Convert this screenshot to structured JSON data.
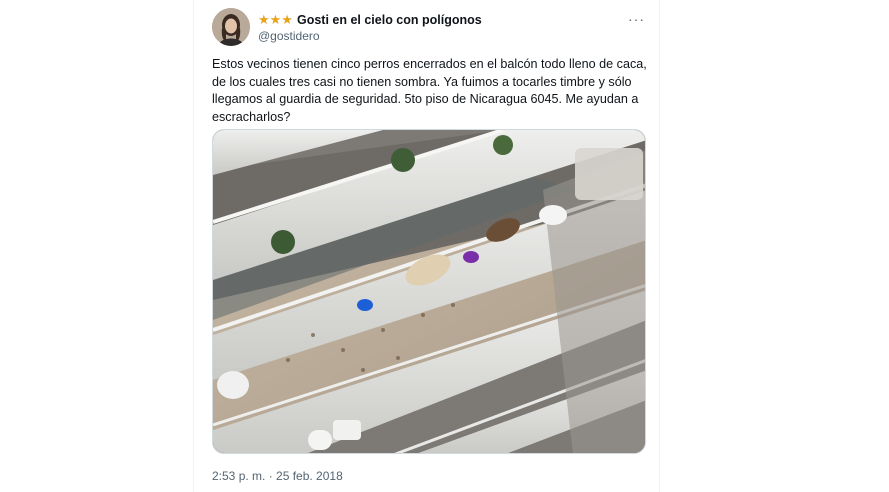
{
  "tweet": {
    "stars": "★★★",
    "display_name": "Gosti en el cielo con polígonos",
    "handle": "@gostidero",
    "more_label": "···",
    "text": "Estos vecinos tienen cinco perros encerrados en el balcón todo lleno de caca, de los cuales tres casi no tienen sombra. Ya fuimos a tocarles timbre y sólo llegamos al guardia de seguridad. 5to piso de Nicaragua 6045. Me ayudan a escracharlos?",
    "timestamp": "2:53 p. m. · 25 feb. 2018",
    "star_color": "#e8a31a"
  },
  "media": {
    "icon": "photo-of-balconies-with-dogs"
  }
}
